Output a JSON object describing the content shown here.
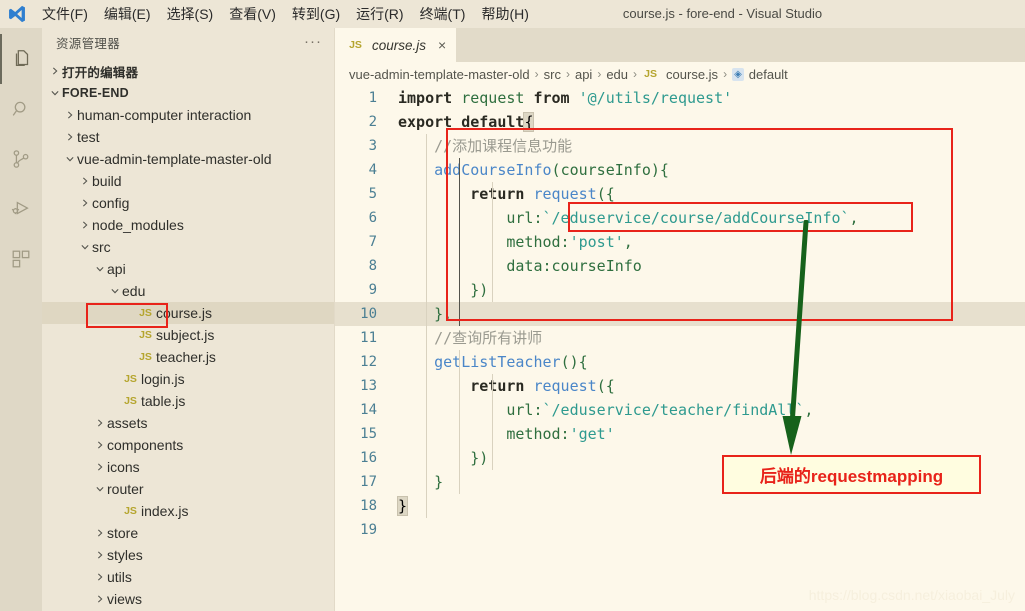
{
  "window": {
    "title": "course.js - fore-end - Visual Studio",
    "logo_icon": "vscode-logo-icon"
  },
  "menu": {
    "items": [
      {
        "label": "文件(F)",
        "name": "menu-file"
      },
      {
        "label": "编辑(E)",
        "name": "menu-edit"
      },
      {
        "label": "选择(S)",
        "name": "menu-selection"
      },
      {
        "label": "查看(V)",
        "name": "menu-view"
      },
      {
        "label": "转到(G)",
        "name": "menu-goto"
      },
      {
        "label": "运行(R)",
        "name": "menu-run"
      },
      {
        "label": "终端(T)",
        "name": "menu-terminal"
      },
      {
        "label": "帮助(H)",
        "name": "menu-help"
      }
    ]
  },
  "activitybar": {
    "items": [
      {
        "icon": "files-explorer-icon",
        "active": true
      },
      {
        "icon": "search-icon",
        "active": false
      },
      {
        "icon": "source-control-icon",
        "active": false
      },
      {
        "icon": "run-and-debug-icon",
        "active": false
      },
      {
        "icon": "extensions-icon",
        "active": false
      }
    ]
  },
  "sidebar": {
    "header": {
      "title": "资源管理器",
      "more_actions": "···"
    },
    "tree": [
      {
        "label": "打开的编辑器",
        "depth": 0,
        "twisty": "collapsed",
        "bold": true,
        "kind": "section"
      },
      {
        "label": "FORE-END",
        "depth": 0,
        "twisty": "expanded",
        "bold": true,
        "kind": "section"
      },
      {
        "label": "human-computer interaction",
        "depth": 1,
        "twisty": "collapsed",
        "kind": "folder"
      },
      {
        "label": "test",
        "depth": 1,
        "twisty": "collapsed",
        "kind": "folder"
      },
      {
        "label": "vue-admin-template-master-old",
        "depth": 1,
        "twisty": "expanded",
        "kind": "folder"
      },
      {
        "label": "build",
        "depth": 2,
        "twisty": "collapsed",
        "kind": "folder"
      },
      {
        "label": "config",
        "depth": 2,
        "twisty": "collapsed",
        "kind": "folder"
      },
      {
        "label": "node_modules",
        "depth": 2,
        "twisty": "collapsed",
        "kind": "folder"
      },
      {
        "label": "src",
        "depth": 2,
        "twisty": "expanded",
        "kind": "folder"
      },
      {
        "label": "api",
        "depth": 3,
        "twisty": "expanded",
        "kind": "folder"
      },
      {
        "label": "edu",
        "depth": 4,
        "twisty": "expanded",
        "kind": "folder"
      },
      {
        "label": "course.js",
        "depth": 5,
        "twisty": "none",
        "kind": "js",
        "selected": true,
        "highlighted": true
      },
      {
        "label": "subject.js",
        "depth": 5,
        "twisty": "none",
        "kind": "js"
      },
      {
        "label": "teacher.js",
        "depth": 5,
        "twisty": "none",
        "kind": "js"
      },
      {
        "label": "login.js",
        "depth": 4,
        "twisty": "none",
        "kind": "js"
      },
      {
        "label": "table.js",
        "depth": 4,
        "twisty": "none",
        "kind": "js"
      },
      {
        "label": "assets",
        "depth": 3,
        "twisty": "collapsed",
        "kind": "folder"
      },
      {
        "label": "components",
        "depth": 3,
        "twisty": "collapsed",
        "kind": "folder"
      },
      {
        "label": "icons",
        "depth": 3,
        "twisty": "collapsed",
        "kind": "folder"
      },
      {
        "label": "router",
        "depth": 3,
        "twisty": "expanded",
        "kind": "folder"
      },
      {
        "label": "index.js",
        "depth": 4,
        "twisty": "none",
        "kind": "js"
      },
      {
        "label": "store",
        "depth": 3,
        "twisty": "collapsed",
        "kind": "folder"
      },
      {
        "label": "styles",
        "depth": 3,
        "twisty": "collapsed",
        "kind": "folder"
      },
      {
        "label": "utils",
        "depth": 3,
        "twisty": "collapsed",
        "kind": "folder"
      },
      {
        "label": "views",
        "depth": 3,
        "twisty": "collapsed",
        "kind": "folder"
      }
    ]
  },
  "editor": {
    "tabs": [
      {
        "label": "course.js",
        "badge": "JS",
        "close": "×",
        "active": true
      }
    ],
    "breadcrumb": [
      {
        "label": "vue-admin-template-master-old",
        "icon": ""
      },
      {
        "label": "src",
        "icon": ""
      },
      {
        "label": "api",
        "icon": ""
      },
      {
        "label": "edu",
        "icon": ""
      },
      {
        "label": "course.js",
        "icon": "js-badge"
      },
      {
        "label": "default",
        "icon": "symbol-default-icon"
      }
    ],
    "separator": "›",
    "current_line": 10,
    "lines": [
      {
        "n": 1,
        "tokens": [
          {
            "t": "import",
            "c": "kw"
          },
          {
            "t": " ",
            "c": "plain"
          },
          {
            "t": "request",
            "c": "id"
          },
          {
            "t": " ",
            "c": "plain"
          },
          {
            "t": "from",
            "c": "kw"
          },
          {
            "t": " ",
            "c": "plain"
          },
          {
            "t": "'@/utils/request'",
            "c": "str"
          }
        ]
      },
      {
        "n": 2,
        "tokens": [
          {
            "t": "export",
            "c": "kw"
          },
          {
            "t": " ",
            "c": "plain"
          },
          {
            "t": "default",
            "c": "kw"
          },
          {
            "t": "{",
            "c": "brmatch"
          }
        ]
      },
      {
        "n": 3,
        "tokens": [
          {
            "t": "    ",
            "c": "plain"
          },
          {
            "t": "//添加课程信息功能",
            "c": "cmt"
          }
        ]
      },
      {
        "n": 4,
        "tokens": [
          {
            "t": "    ",
            "c": "plain"
          },
          {
            "t": "addCourseInfo",
            "c": "fn"
          },
          {
            "t": "(",
            "c": "punc"
          },
          {
            "t": "courseInfo",
            "c": "id"
          },
          {
            "t": ")",
            "c": "punc"
          },
          {
            "t": "{",
            "c": "brace"
          }
        ]
      },
      {
        "n": 5,
        "tokens": [
          {
            "t": "        ",
            "c": "plain"
          },
          {
            "t": "return",
            "c": "kw"
          },
          {
            "t": " ",
            "c": "plain"
          },
          {
            "t": "request",
            "c": "fn"
          },
          {
            "t": "(",
            "c": "punc"
          },
          {
            "t": "{",
            "c": "brace"
          }
        ]
      },
      {
        "n": 6,
        "tokens": [
          {
            "t": "            ",
            "c": "plain"
          },
          {
            "t": "url:",
            "c": "id"
          },
          {
            "t": "`/eduservice/course/addCourseInfo`",
            "c": "str"
          },
          {
            "t": ",",
            "c": "punc"
          }
        ]
      },
      {
        "n": 7,
        "tokens": [
          {
            "t": "            ",
            "c": "plain"
          },
          {
            "t": "method:",
            "c": "id"
          },
          {
            "t": "'post'",
            "c": "str"
          },
          {
            "t": ",",
            "c": "punc"
          }
        ]
      },
      {
        "n": 8,
        "tokens": [
          {
            "t": "            ",
            "c": "plain"
          },
          {
            "t": "data:",
            "c": "id"
          },
          {
            "t": "courseInfo",
            "c": "id"
          }
        ]
      },
      {
        "n": 9,
        "tokens": [
          {
            "t": "        ",
            "c": "plain"
          },
          {
            "t": "})",
            "c": "brace"
          }
        ]
      },
      {
        "n": 10,
        "tokens": [
          {
            "t": "    ",
            "c": "plain"
          },
          {
            "t": "},",
            "c": "brace"
          }
        ]
      },
      {
        "n": 11,
        "tokens": [
          {
            "t": "    ",
            "c": "plain"
          },
          {
            "t": "//查询所有讲师",
            "c": "cmt"
          }
        ]
      },
      {
        "n": 12,
        "tokens": [
          {
            "t": "    ",
            "c": "plain"
          },
          {
            "t": "getListTeacher",
            "c": "fn"
          },
          {
            "t": "()",
            "c": "punc"
          },
          {
            "t": "{",
            "c": "brace"
          }
        ]
      },
      {
        "n": 13,
        "tokens": [
          {
            "t": "        ",
            "c": "plain"
          },
          {
            "t": "return",
            "c": "kw"
          },
          {
            "t": " ",
            "c": "plain"
          },
          {
            "t": "request",
            "c": "fn"
          },
          {
            "t": "(",
            "c": "punc"
          },
          {
            "t": "{",
            "c": "brace"
          }
        ]
      },
      {
        "n": 14,
        "tokens": [
          {
            "t": "            ",
            "c": "plain"
          },
          {
            "t": "url:",
            "c": "id"
          },
          {
            "t": "`/eduservice/teacher/findAll`",
            "c": "str"
          },
          {
            "t": ",",
            "c": "punc"
          }
        ]
      },
      {
        "n": 15,
        "tokens": [
          {
            "t": "            ",
            "c": "plain"
          },
          {
            "t": "method:",
            "c": "id"
          },
          {
            "t": "'get'",
            "c": "str"
          }
        ]
      },
      {
        "n": 16,
        "tokens": [
          {
            "t": "        ",
            "c": "plain"
          },
          {
            "t": "})",
            "c": "brace"
          }
        ]
      },
      {
        "n": 17,
        "tokens": [
          {
            "t": "    ",
            "c": "plain"
          },
          {
            "t": "}",
            "c": "brace"
          }
        ]
      },
      {
        "n": 18,
        "tokens": [
          {
            "t": "}",
            "c": "brmatch"
          }
        ]
      },
      {
        "n": 19,
        "tokens": []
      }
    ]
  },
  "annotations": {
    "callout": {
      "text": "后端的requestmapping",
      "color": "#E8231A",
      "background": "#FFFDE0"
    },
    "box_color": "#E8231A",
    "arrow_color": "#16621B",
    "boxes": [
      {
        "name": "sidebar-course-js-highlight"
      },
      {
        "name": "code-block-highlight"
      },
      {
        "name": "url-value-highlight"
      }
    ]
  },
  "watermark": {
    "text": "https://blog.csdn.net/xiaobai_July"
  }
}
